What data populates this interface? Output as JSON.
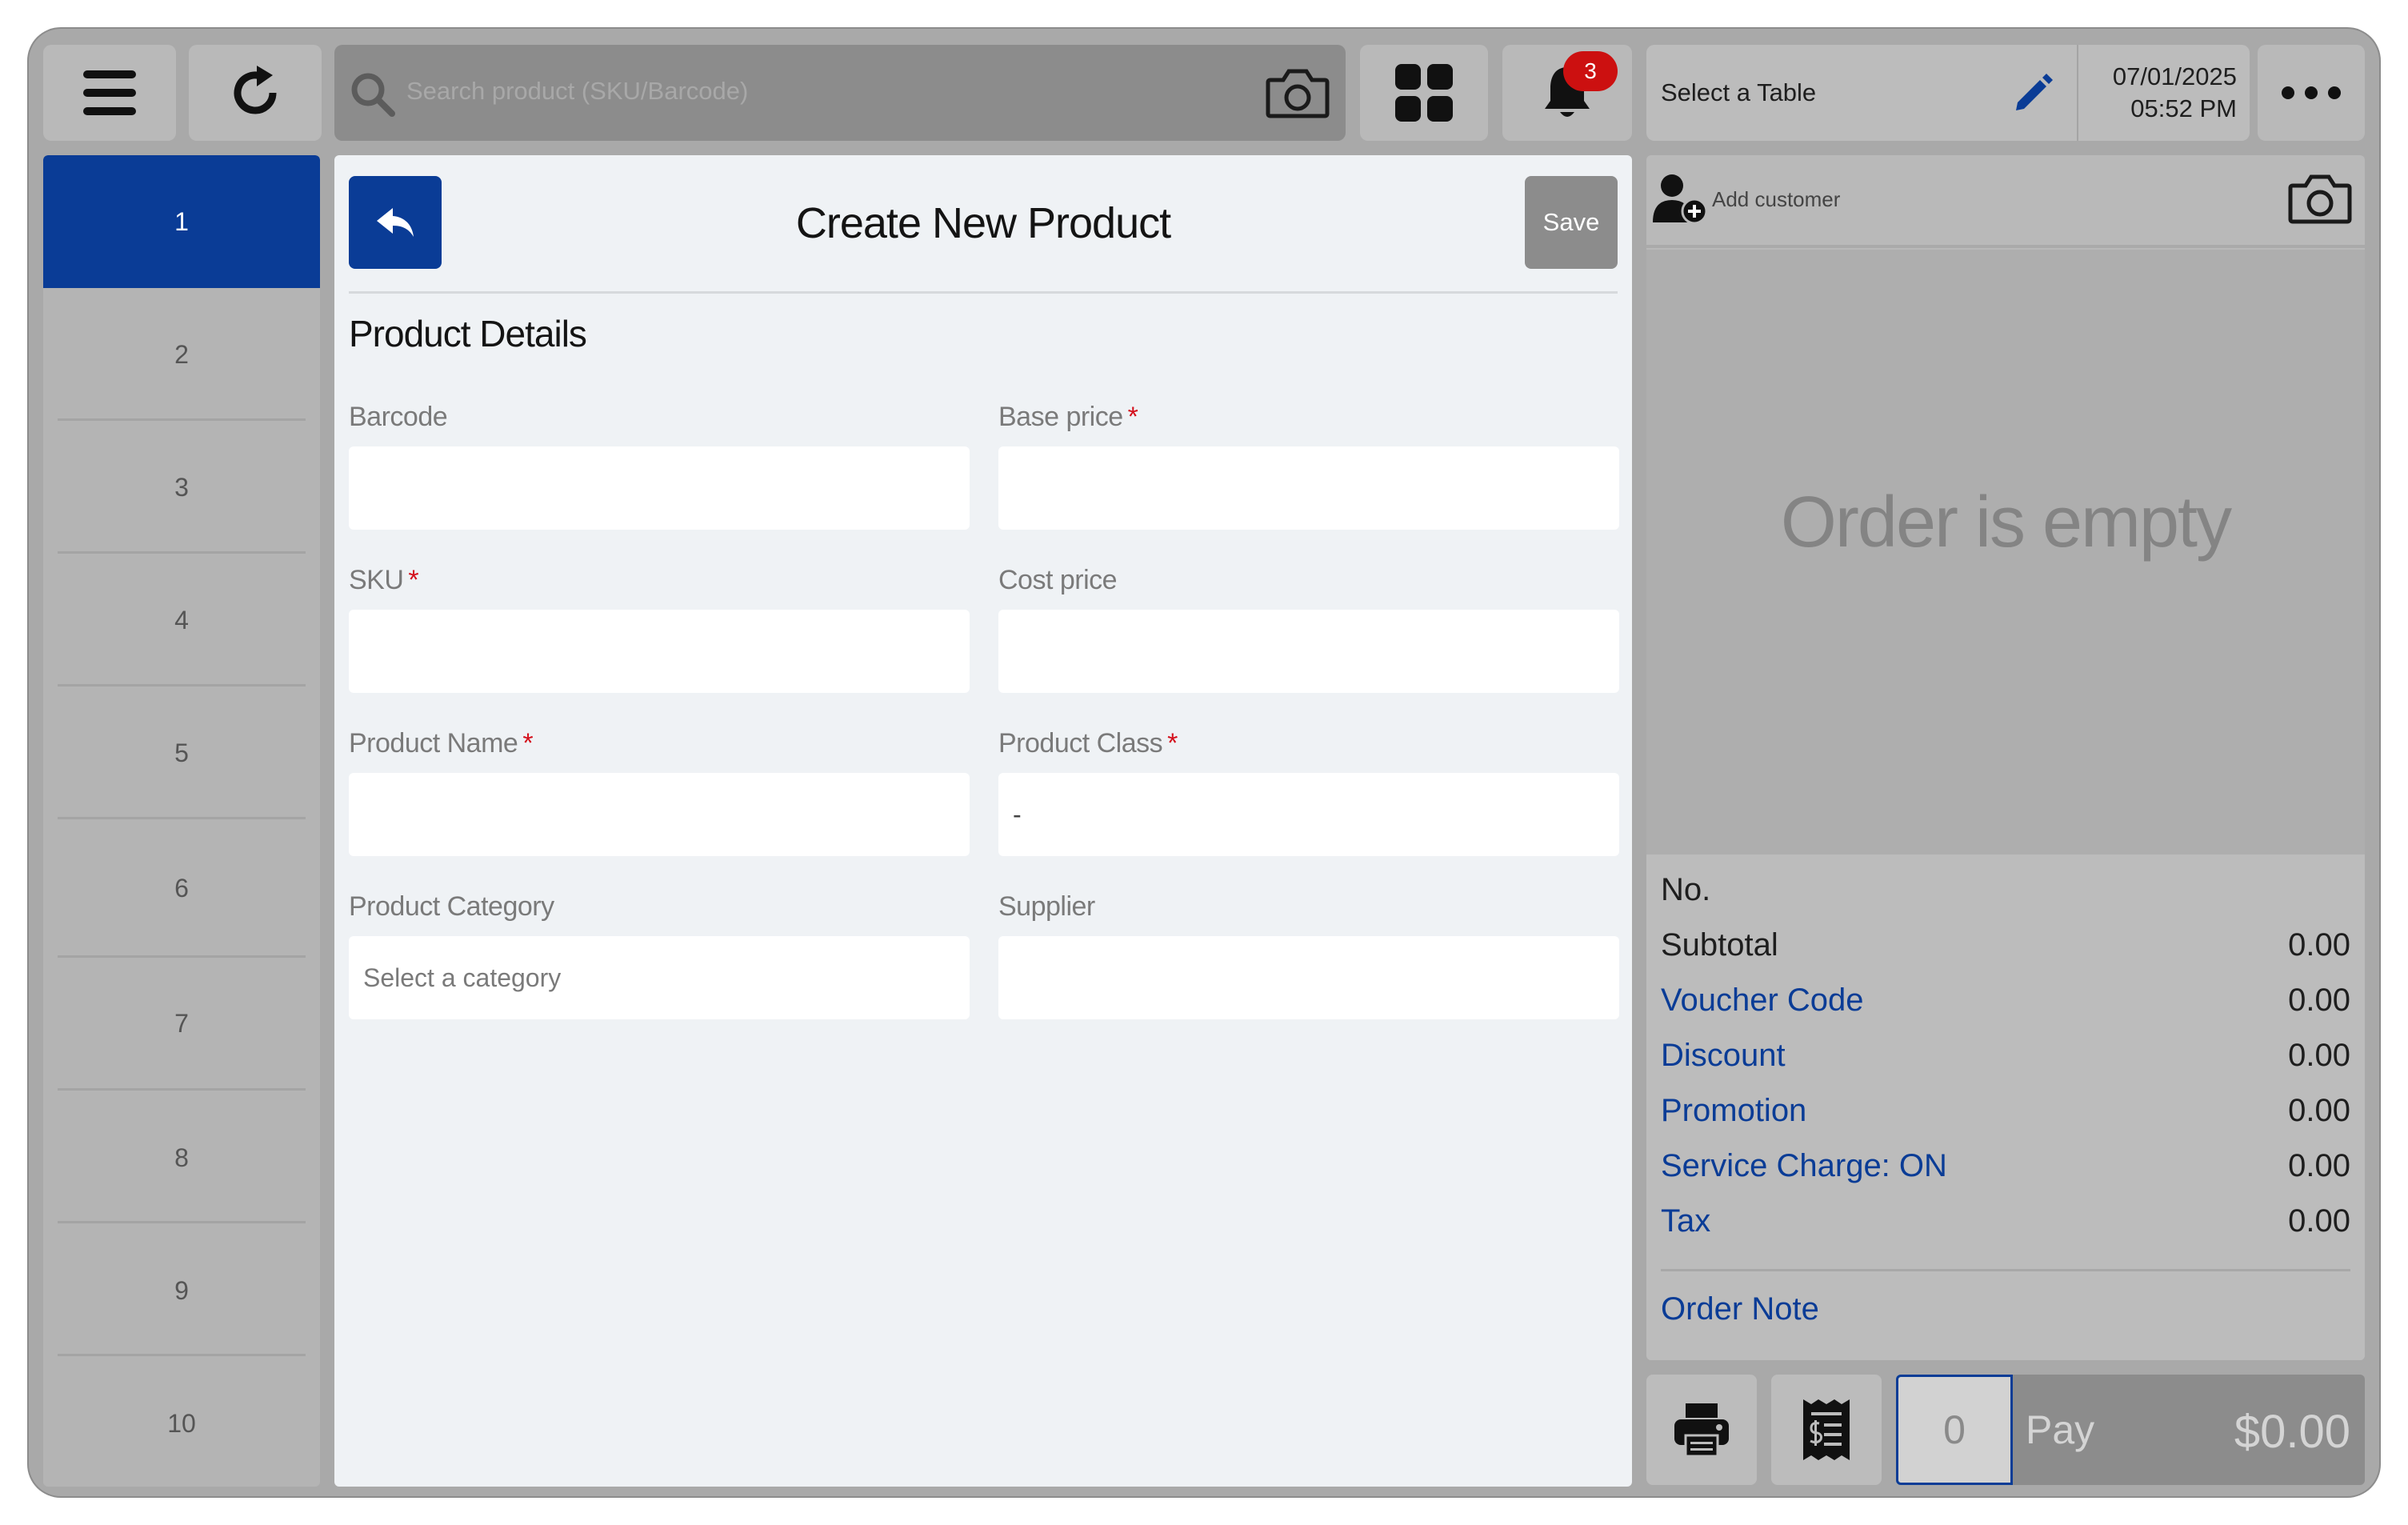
{
  "topbar": {
    "search_placeholder": "Search product (SKU/Barcode)",
    "notification_count": "3",
    "table_label": "Select a Table",
    "date": "07/01/2025",
    "time": "05:52 PM"
  },
  "orders": [
    "1",
    "2",
    "3",
    "4",
    "5",
    "6",
    "7",
    "8",
    "9",
    "10"
  ],
  "form": {
    "title": "Create New Product",
    "save_label": "Save",
    "section_title": "Product Details",
    "required_mark": "*",
    "fields": {
      "barcode": {
        "label": "Barcode",
        "value": ""
      },
      "base_price": {
        "label": "Base price",
        "value": ""
      },
      "sku": {
        "label": "SKU",
        "value": ""
      },
      "cost_price": {
        "label": "Cost price",
        "value": ""
      },
      "product_name": {
        "label": "Product Name",
        "value": ""
      },
      "product_class": {
        "label": "Product Class",
        "value": "-"
      },
      "product_category": {
        "label": "Product Category",
        "placeholder": "Select a category"
      },
      "supplier": {
        "label": "Supplier",
        "value": ""
      }
    }
  },
  "order_panel": {
    "add_customer": "Add customer",
    "empty_text": "Order is empty",
    "no_label": "No.",
    "rows": [
      {
        "label": "Subtotal",
        "value": "0.00"
      },
      {
        "label": "Voucher Code",
        "value": "0.00"
      },
      {
        "label": "Discount",
        "value": "0.00"
      },
      {
        "label": "Promotion",
        "value": "0.00"
      },
      {
        "label": "Service Charge: ON",
        "value": "0.00"
      },
      {
        "label": "Tax",
        "value": "0.00"
      }
    ],
    "order_note": "Order Note",
    "quantity": "0",
    "pay_label": "Pay",
    "pay_amount": "$0.00"
  },
  "colors": {
    "accent_blue": "#0a3c96",
    "required_red": "#d4101c",
    "badge_red": "#cc1010"
  },
  "icons": [
    "menu-icon",
    "refresh-icon",
    "search-icon",
    "camera-icon",
    "grid-icon",
    "bell-icon",
    "pencil-icon",
    "more-icon",
    "back-arrow-icon",
    "add-customer-icon",
    "printer-icon",
    "receipt-icon"
  ]
}
